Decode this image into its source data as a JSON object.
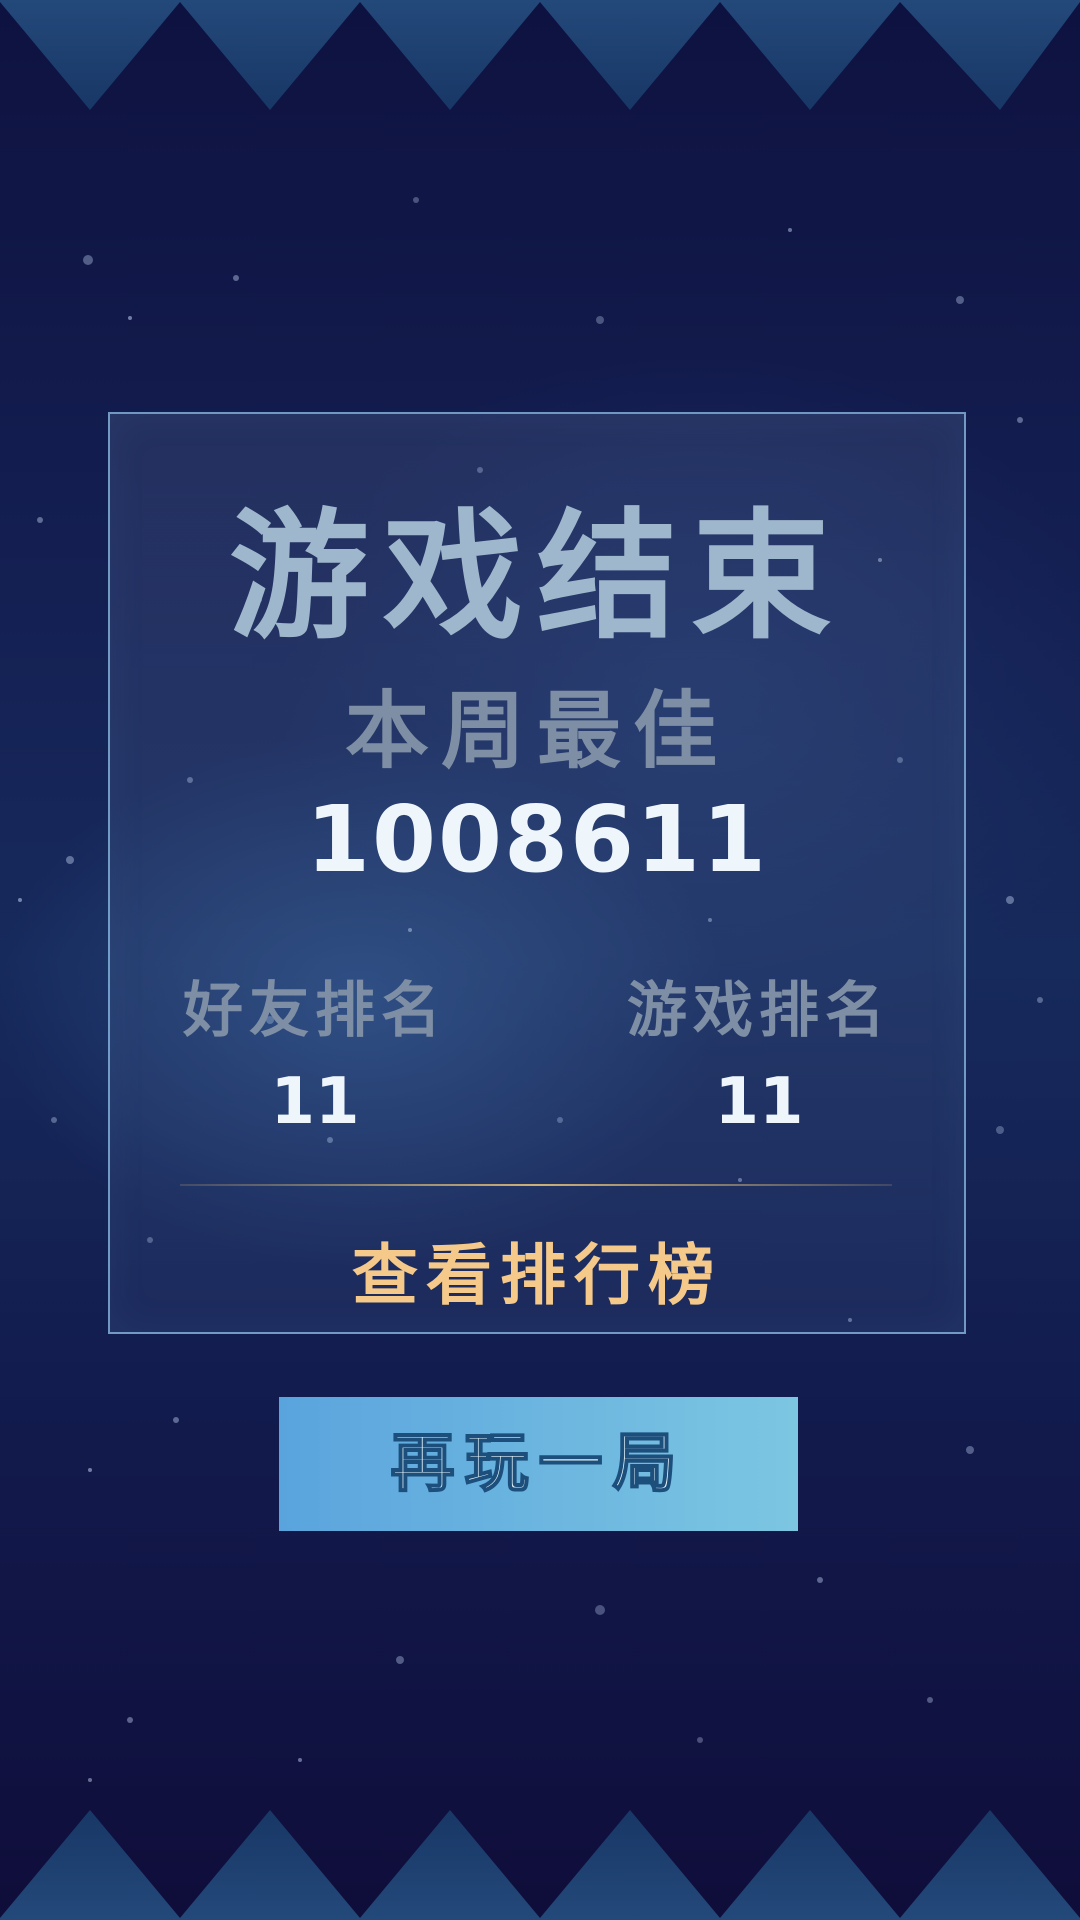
{
  "game_over": {
    "title": "游戏结束",
    "best_label": "本周最佳",
    "best_score": "1008611",
    "friend_rank_label": "好友排名",
    "friend_rank_value": "11",
    "game_rank_label": "游戏排名",
    "game_rank_value": "11",
    "leaderboard_label": "查看排行榜",
    "replay_label": "再玩一局"
  },
  "colors": {
    "background": "#141f52",
    "spike": "#1f4170",
    "panel_border": "#8cbee6",
    "title_text": "#9fb7cc",
    "label_text": "#7e8fa5",
    "value_text": "#eef6fb",
    "leaderboard_text": "#f4c98a",
    "button_gradient_start": "#5aa4de",
    "button_gradient_end": "#7cc6e2"
  }
}
